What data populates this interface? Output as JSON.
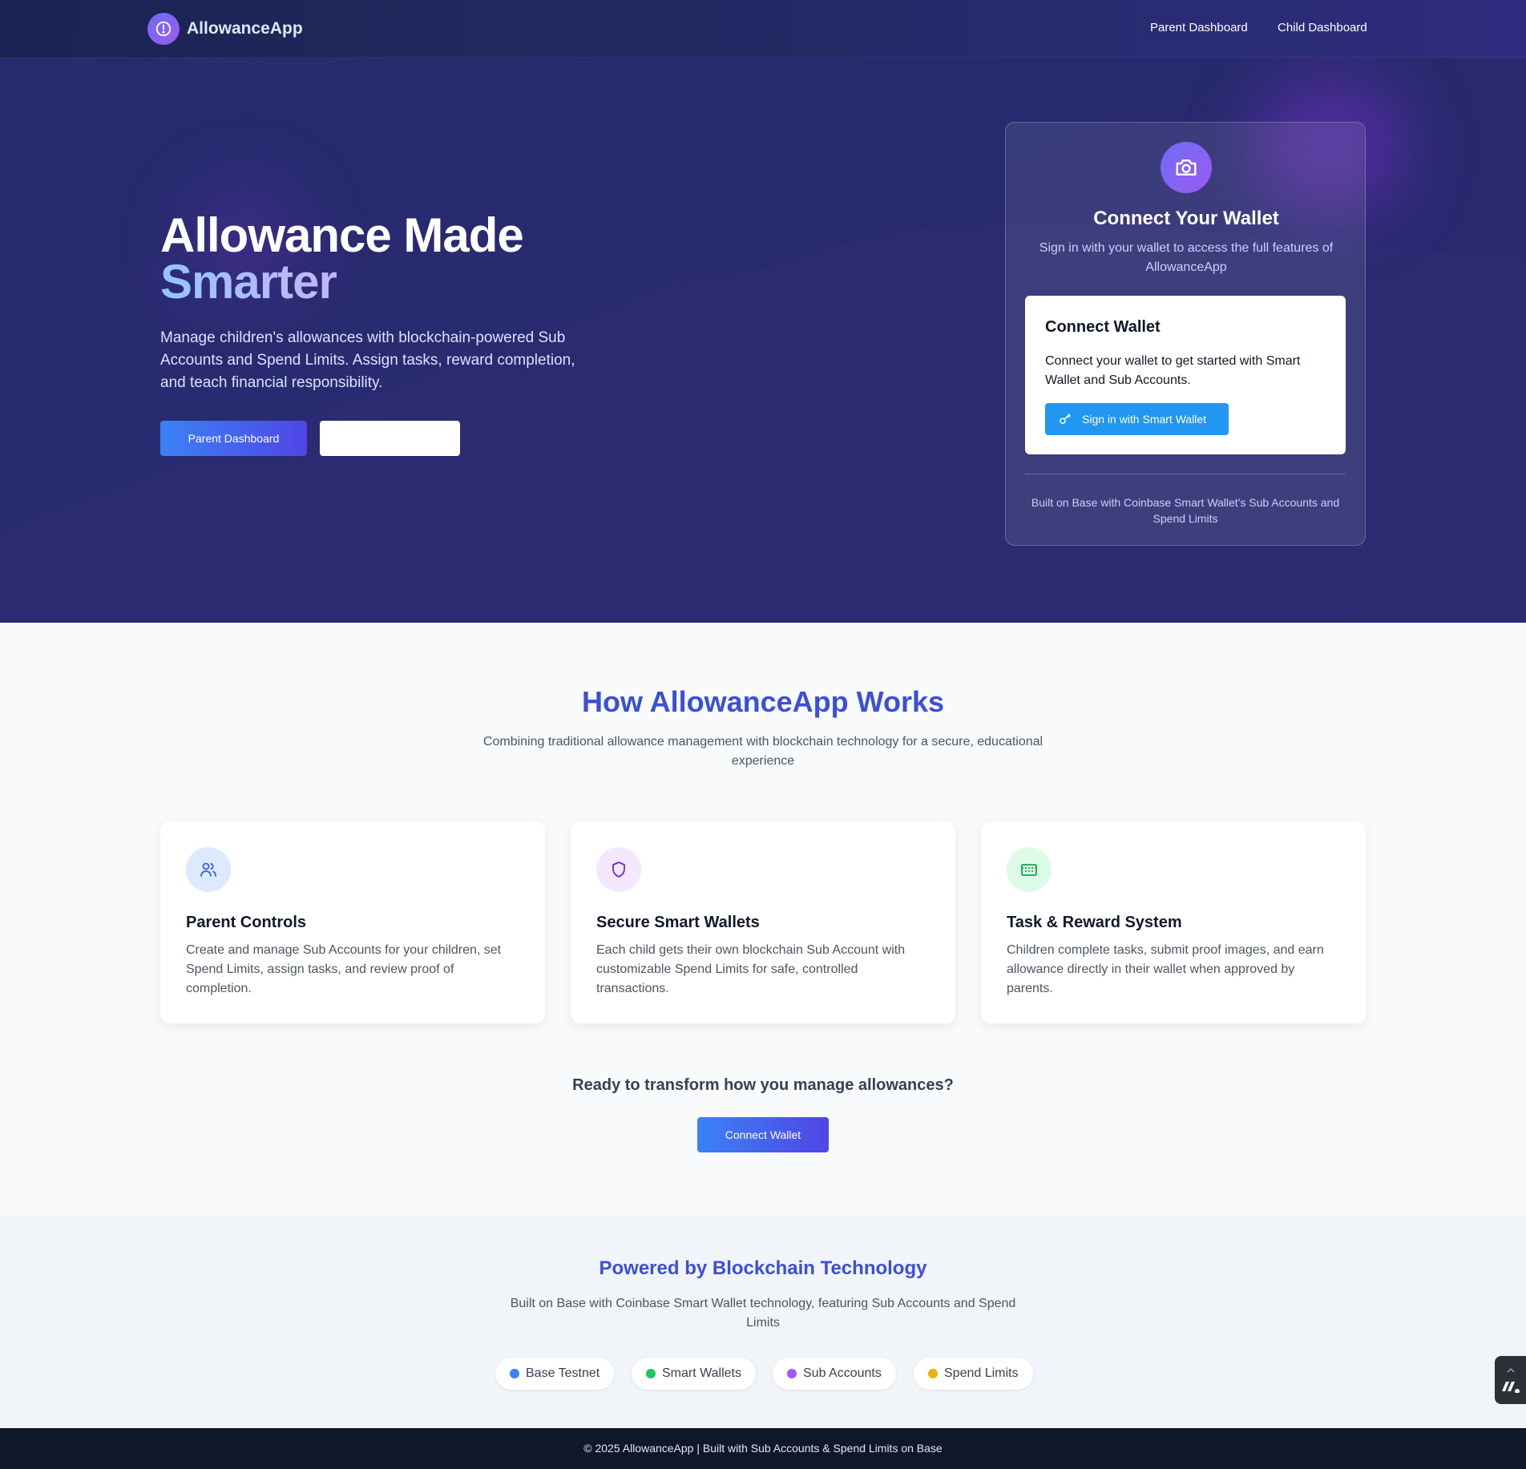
{
  "nav": {
    "brand": "AllowanceApp",
    "links": [
      {
        "label": "Parent Dashboard"
      },
      {
        "label": "Child Dashboard"
      }
    ]
  },
  "hero": {
    "title_line1": "Allowance Made",
    "title_line2": "Smarter",
    "description": "Manage children's allowances with blockchain-powered Sub Accounts and Spend Limits. Assign tasks, reward completion, and teach financial responsibility.",
    "primary_button": "Parent Dashboard",
    "secondary_button": ""
  },
  "wallet_card": {
    "icon": "camera-icon",
    "title": "Connect Your Wallet",
    "subtitle": "Sign in with your wallet to access the full features of AllowanceApp",
    "inner": {
      "title": "Connect Wallet",
      "description": "Connect your wallet to get started with Smart Wallet and Sub Accounts.",
      "button": "Sign in with Smart Wallet",
      "button_icon": "key-icon"
    },
    "footer": "Built on Base with Coinbase Smart Wallet's Sub Accounts and Spend Limits"
  },
  "how": {
    "title": "How AllowanceApp Works",
    "subtitle": "Combining traditional allowance management with blockchain technology for a secure, educational experience",
    "features": [
      {
        "icon": "users-icon",
        "title": "Parent Controls",
        "description": "Create and manage Sub Accounts for your children, set Spend Limits, assign tasks, and review proof of completion."
      },
      {
        "icon": "shield-icon",
        "title": "Secure Smart Wallets",
        "description": "Each child gets their own blockchain Sub Account with customizable Spend Limits for safe, controlled transactions."
      },
      {
        "icon": "wallet-icon",
        "title": "Task & Reward System",
        "description": "Children complete tasks, submit proof images, and earn allowance directly in their wallet when approved by parents."
      }
    ],
    "cta_text": "Ready to transform how you manage allowances?",
    "cta_button": "Connect Wallet"
  },
  "powered": {
    "title": "Powered by Blockchain Technology",
    "subtitle": "Built on Base with Coinbase Smart Wallet technology, featuring Sub Accounts and Spend Limits",
    "pills": [
      {
        "label": "Base Testnet",
        "color": "#3b82f6"
      },
      {
        "label": "Smart Wallets",
        "color": "#22c55e"
      },
      {
        "label": "Sub Accounts",
        "color": "#a855f7"
      },
      {
        "label": "Spend Limits",
        "color": "#eab308"
      }
    ]
  },
  "footer": {
    "text": "© 2025 AllowanceApp | Built with Sub Accounts & Spend Limits on Base"
  },
  "colors": {
    "accent": "#3b4fd8",
    "hero_bg": "#262b6e",
    "button_blue": "#2196f3"
  }
}
